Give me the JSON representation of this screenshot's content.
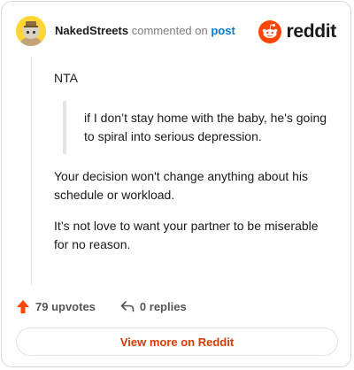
{
  "header": {
    "author": "NakedStreets",
    "action": "commented on",
    "post_link": "post",
    "brand": "reddit"
  },
  "comment": {
    "paragraph1": "NTA",
    "quote": "if I don’t stay home with the baby, he's going to spiral into serious depression.",
    "paragraph2": "Your decision won't change anything about his schedule or workload.",
    "paragraph3": "It’s not love to want your partner to be miserable for no reason."
  },
  "footer": {
    "upvotes": "79 upvotes",
    "replies": "0 replies",
    "view_more": "View more on Reddit"
  },
  "colors": {
    "upvote": "#ff4500",
    "brand": "#ff4500",
    "link": "#0079d3",
    "view_more": "#d93a00",
    "avatar_bg": "#ffd635"
  },
  "icons": [
    "avatar-snoo-icon",
    "reddit-logo-icon",
    "upvote-arrow-icon",
    "reply-arrow-icon"
  ]
}
